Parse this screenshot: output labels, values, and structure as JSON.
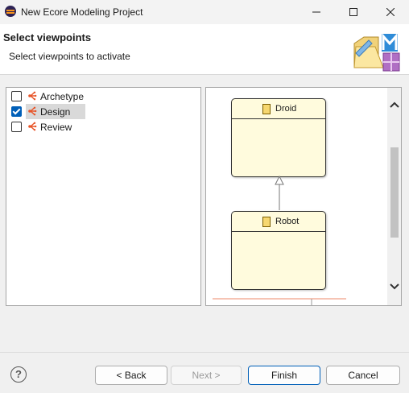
{
  "window": {
    "title": "New Ecore Modeling Project"
  },
  "header": {
    "title": "Select viewpoints",
    "description": "Select viewpoints to activate"
  },
  "viewpoints": [
    {
      "label": "Archetype",
      "checked": false,
      "selected": false
    },
    {
      "label": "Design",
      "checked": true,
      "selected": true
    },
    {
      "label": "Review",
      "checked": false,
      "selected": false
    }
  ],
  "preview": {
    "classes": [
      "Droid",
      "Robot"
    ]
  },
  "buttons": {
    "back": "< Back",
    "next": "Next >",
    "finish": "Finish",
    "cancel": "Cancel",
    "help": "?"
  },
  "colors": {
    "accent": "#005fb8",
    "class_fill": "#fffbdd",
    "viewpoint_icon": "#e8562a"
  }
}
